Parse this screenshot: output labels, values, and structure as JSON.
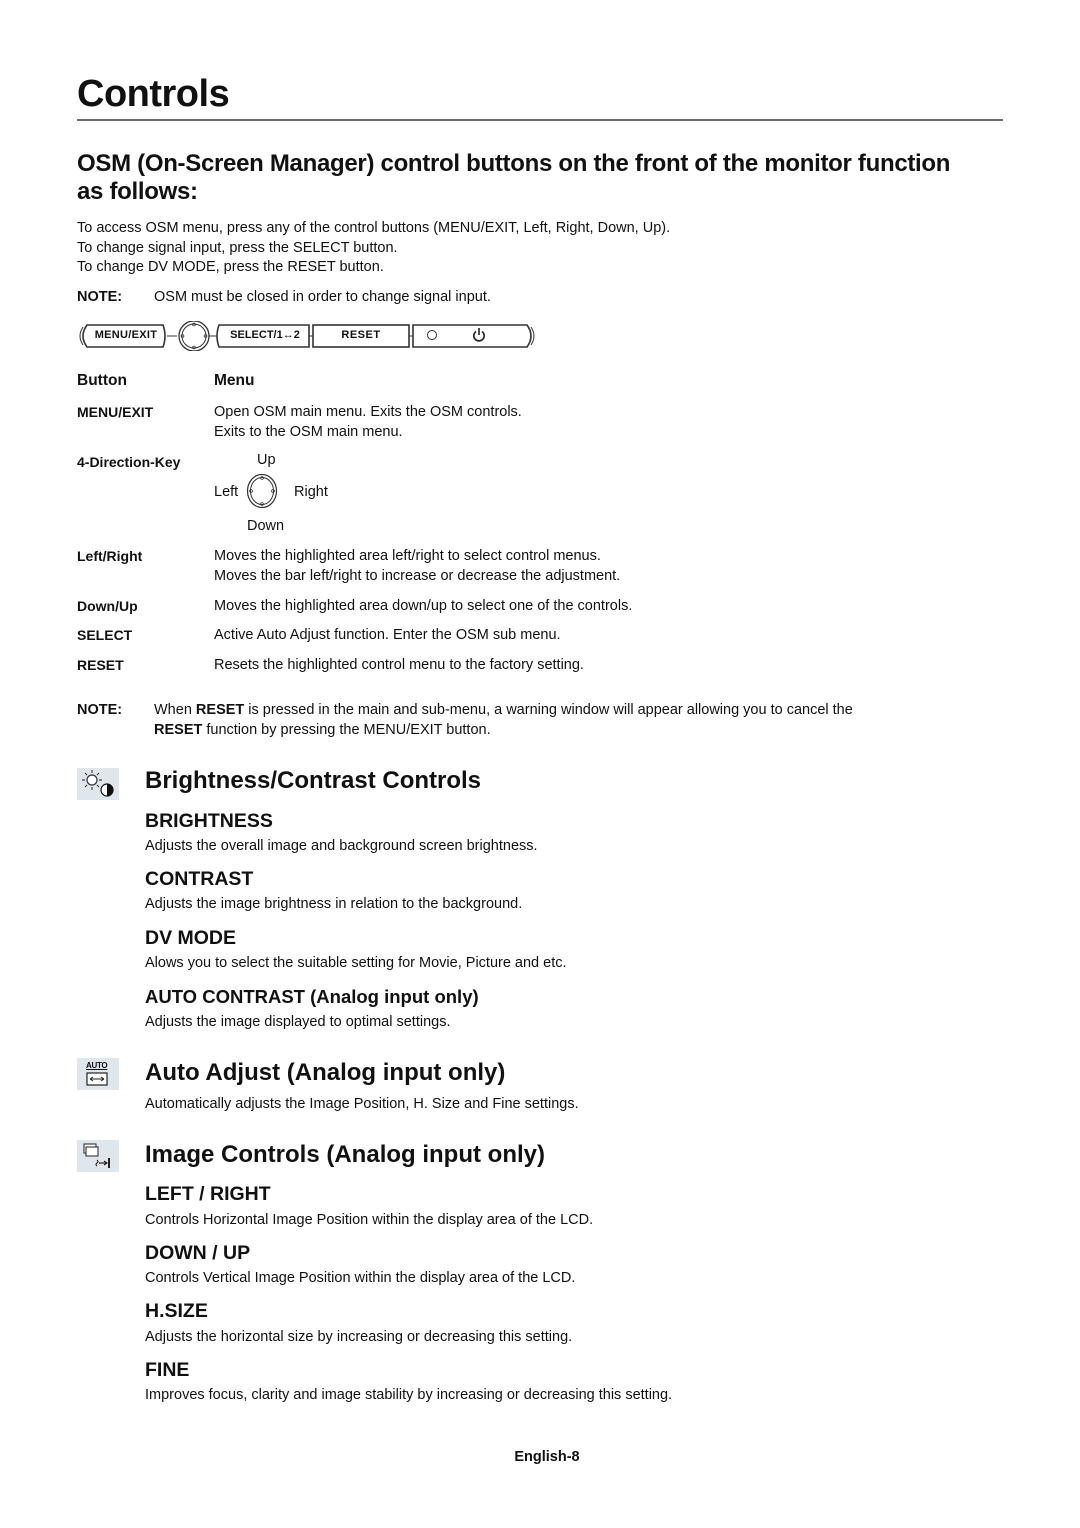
{
  "page": {
    "title": "Controls",
    "subtitle": "OSM (On-Screen Manager) control buttons on the front of the monitor function as follows:",
    "intro_lines": [
      "To access OSM menu, press any of the control buttons (MENU/EXIT, Left, Right, Down, Up).",
      "To change signal input, press the SELECT button.",
      "To change DV MODE, press the RESET button."
    ],
    "note1": {
      "label": "NOTE:",
      "text": "OSM must be closed in order to change signal input."
    }
  },
  "button_bar": {
    "menu_exit": "MENU/EXIT",
    "select": "SELECT/1↔2",
    "reset": "RESET",
    "indicator_icon": "power-led-icon",
    "power_icon": "power-icon"
  },
  "table": {
    "headers": {
      "button": "Button",
      "menu": "Menu"
    },
    "rows": [
      {
        "button": "MENU/EXIT",
        "lines": [
          "Open OSM main menu. Exits the OSM controls.",
          "Exits to the OSM main menu."
        ]
      },
      {
        "button": "4-Direction-Key",
        "dirkey": {
          "up": "Up",
          "left": "Left",
          "right": "Right",
          "down": "Down"
        }
      },
      {
        "button": "Left/Right",
        "lines": [
          "Moves the highlighted area left/right to select control menus.",
          "Moves the bar left/right to increase or decrease the adjustment."
        ]
      },
      {
        "button": "Down/Up",
        "lines": [
          "Moves the highlighted area down/up to select one of the controls."
        ]
      },
      {
        "button": "SELECT",
        "lines": [
          "Active Auto Adjust function. Enter the OSM sub menu."
        ]
      },
      {
        "button": "RESET",
        "lines": [
          "Resets the highlighted control menu to the factory setting."
        ]
      }
    ]
  },
  "note2": {
    "label": "NOTE:",
    "pre": "When ",
    "bold1": "RESET",
    "mid": " is pressed in the main and sub-menu, a warning window will appear allowing you to cancel the",
    "bold2": "RESET",
    "post": " function by pressing the MENU/EXIT button."
  },
  "sections": [
    {
      "title": "Brightness/Contrast Controls",
      "icon": "brightness-contrast-icon",
      "items": [
        {
          "title": "BRIGHTNESS",
          "desc": "Adjusts the overall image and background screen brightness."
        },
        {
          "title": "CONTRAST",
          "desc": "Adjusts the image brightness in relation to the background."
        },
        {
          "title": "DV MODE",
          "desc": "Alows you to select the suitable setting for Movie, Picture and etc."
        },
        {
          "title": "AUTO CONTRAST (Analog input only)",
          "desc": "Adjusts the image displayed to optimal settings."
        }
      ]
    },
    {
      "title": "Auto Adjust (Analog input only)",
      "icon": "auto-adjust-icon",
      "icon_text": "AUTO",
      "desc": "Automatically adjusts the Image Position, H. Size and Fine settings."
    },
    {
      "title": "Image Controls (Analog input only)",
      "icon": "image-controls-icon",
      "items": [
        {
          "title": "LEFT / RIGHT",
          "desc": "Controls Horizontal Image Position within the display area of the LCD."
        },
        {
          "title": "DOWN / UP",
          "desc": "Controls Vertical Image Position within the display area of the LCD."
        },
        {
          "title": "H.SIZE",
          "desc": "Adjusts the horizontal size by increasing or decreasing this setting."
        },
        {
          "title": "FINE",
          "desc": "Improves focus, clarity and image stability by increasing or decreasing this setting."
        }
      ]
    }
  ],
  "footer": {
    "page_label": "English-8"
  }
}
